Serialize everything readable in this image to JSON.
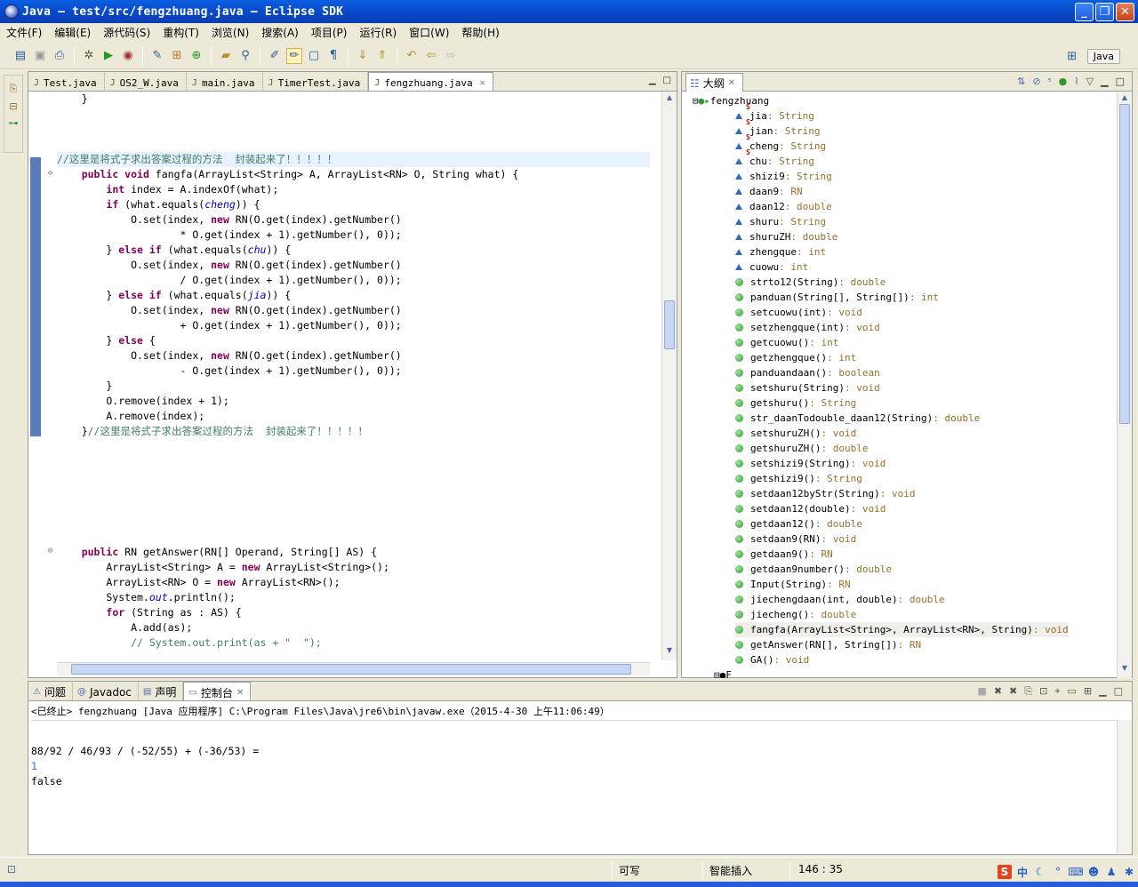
{
  "window": {
    "title": "Java — test/src/fengzhuang.java — Eclipse SDK"
  },
  "menu": [
    "文件(F)",
    "编辑(E)",
    "源代码(S)",
    "重构(T)",
    "浏览(N)",
    "搜索(A)",
    "项目(P)",
    "运行(R)",
    "窗口(W)",
    "帮助(H)"
  ],
  "perspective": {
    "label": "Java"
  },
  "editor": {
    "tabs": [
      {
        "label": "Test.java",
        "active": false
      },
      {
        "label": "OS2_W.java",
        "active": false
      },
      {
        "label": "main.java",
        "active": false
      },
      {
        "label": "TimerTest.java",
        "active": false
      },
      {
        "label": "fengzhuang.java",
        "active": true
      }
    ],
    "lines": [
      {
        "row": 0,
        "html": "    }"
      },
      {
        "row": 4,
        "html": "<span class=\"cm\">//这里是将式子求出答案过程的方法  封装起来了！！！！！</span>",
        "current": true
      },
      {
        "row": 5,
        "html": "    <span class=\"kw\">public void</span> fangfa(ArrayList&lt;String&gt; A, ArrayList&lt;RN&gt; O, String what) {",
        "fold": true
      },
      {
        "row": 6,
        "html": "        <span class=\"kw\">int</span> index = A.indexOf(what);"
      },
      {
        "row": 7,
        "html": "        <span class=\"kw\">if</span> (what.equals(<span class=\"it\">cheng</span>)) {"
      },
      {
        "row": 8,
        "html": "            O.set(index, <span class=\"kw\">new</span> RN(O.get(index).getNumber()"
      },
      {
        "row": 9,
        "html": "                    * O.get(index + 1).getNumber(), 0));"
      },
      {
        "row": 10,
        "html": "        } <span class=\"kw\">else if</span> (what.equals(<span class=\"it\">chu</span>)) {"
      },
      {
        "row": 11,
        "html": "            O.set(index, <span class=\"kw\">new</span> RN(O.get(index).getNumber()"
      },
      {
        "row": 12,
        "html": "                    / O.get(index + 1).getNumber(), 0));"
      },
      {
        "row": 13,
        "html": "        } <span class=\"kw\">else if</span> (what.equals(<span class=\"it\">jia</span>)) {"
      },
      {
        "row": 14,
        "html": "            O.set(index, <span class=\"kw\">new</span> RN(O.get(index).getNumber()"
      },
      {
        "row": 15,
        "html": "                    + O.get(index + 1).getNumber(), 0));"
      },
      {
        "row": 16,
        "html": "        } <span class=\"kw\">else</span> {"
      },
      {
        "row": 17,
        "html": "            O.set(index, <span class=\"kw\">new</span> RN(O.get(index).getNumber()"
      },
      {
        "row": 18,
        "html": "                    - O.get(index + 1).getNumber(), 0));"
      },
      {
        "row": 19,
        "html": "        }"
      },
      {
        "row": 20,
        "html": "        O.remove(index + 1);"
      },
      {
        "row": 21,
        "html": "        A.remove(index);"
      },
      {
        "row": 22,
        "html": "    }<span class=\"cm\">//这里是将式子求出答案过程的方法  封装起来了！！！！！</span>"
      },
      {
        "row": 30,
        "html": "    <span class=\"kw\">public</span> RN getAnswer(RN[] Operand, String[] AS) {",
        "fold": true
      },
      {
        "row": 31,
        "html": "        ArrayList&lt;String&gt; A = <span class=\"kw\">new</span> ArrayList&lt;String&gt;();"
      },
      {
        "row": 32,
        "html": "        ArrayList&lt;RN&gt; O = <span class=\"kw\">new</span> ArrayList&lt;RN&gt;();"
      },
      {
        "row": 33,
        "html": "        System.<span class=\"it\">out</span>.println();"
      },
      {
        "row": 34,
        "html": "        <span class=\"kw\">for</span> (String as : AS) {"
      },
      {
        "row": 35,
        "html": "            A.add(as);"
      },
      {
        "row": 36,
        "html": "            <span class=\"cm\">// System.out.print(as + \"  \");</span>"
      }
    ]
  },
  "outline": {
    "title": "大纲",
    "class_name": "fengzhuang",
    "items": [
      {
        "name": "jia",
        "type": " : String",
        "kind": "field",
        "static": true
      },
      {
        "name": "jian",
        "type": " : String",
        "kind": "field",
        "static": true
      },
      {
        "name": "cheng",
        "type": " : String",
        "kind": "field",
        "static": true
      },
      {
        "name": "chu",
        "type": " : String",
        "kind": "field",
        "static": true
      },
      {
        "name": "shizi9",
        "type": " : String",
        "kind": "field"
      },
      {
        "name": "daan9",
        "type": " : RN",
        "kind": "field"
      },
      {
        "name": "daan12",
        "type": " : double",
        "kind": "field"
      },
      {
        "name": "shuru",
        "type": " : String",
        "kind": "field"
      },
      {
        "name": "shuruZH",
        "type": " : double",
        "kind": "field"
      },
      {
        "name": "zhengque",
        "type": " : int",
        "kind": "field"
      },
      {
        "name": "cuowu",
        "type": " : int",
        "kind": "field"
      },
      {
        "name": "strto12(String)",
        "type": " : double",
        "kind": "method"
      },
      {
        "name": "panduan(String[], String[])",
        "type": " : int",
        "kind": "method"
      },
      {
        "name": "setcuowu(int)",
        "type": " : void",
        "kind": "method"
      },
      {
        "name": "setzhengque(int)",
        "type": " : void",
        "kind": "method"
      },
      {
        "name": "getcuowu()",
        "type": " : int",
        "kind": "method"
      },
      {
        "name": "getzhengque()",
        "type": " : int",
        "kind": "method"
      },
      {
        "name": "panduandaan()",
        "type": " : boolean",
        "kind": "method"
      },
      {
        "name": "setshuru(String)",
        "type": " : void",
        "kind": "method"
      },
      {
        "name": "getshuru()",
        "type": " : String",
        "kind": "method"
      },
      {
        "name": "str_daanTodouble_daan12(String)",
        "type": " : double",
        "kind": "method"
      },
      {
        "name": "setshuruZH()",
        "type": " : void",
        "kind": "method"
      },
      {
        "name": "getshuruZH()",
        "type": " : double",
        "kind": "method"
      },
      {
        "name": "setshizi9(String)",
        "type": " : void",
        "kind": "method"
      },
      {
        "name": "getshizi9()",
        "type": " : String",
        "kind": "method"
      },
      {
        "name": "setdaan12byStr(String)",
        "type": " : void",
        "kind": "method"
      },
      {
        "name": "setdaan12(double)",
        "type": " : void",
        "kind": "method"
      },
      {
        "name": "getdaan12()",
        "type": " : double",
        "kind": "method"
      },
      {
        "name": "setdaan9(RN)",
        "type": " : void",
        "kind": "method"
      },
      {
        "name": "getdaan9()",
        "type": " : RN",
        "kind": "method"
      },
      {
        "name": "getdaan9number()",
        "type": " : double",
        "kind": "method"
      },
      {
        "name": "Input(String)",
        "type": " : RN",
        "kind": "method"
      },
      {
        "name": "jiechengdaan(int, double)",
        "type": " : double",
        "kind": "method"
      },
      {
        "name": "jiecheng()",
        "type": " : double",
        "kind": "method"
      },
      {
        "name": "fangfa(ArrayList<String>, ArrayList<RN>, String)",
        "type": " : void",
        "kind": "method",
        "selected": true
      },
      {
        "name": "getAnswer(RN[], String[])",
        "type": " : RN",
        "kind": "method"
      },
      {
        "name": "GA()",
        "type": " : void",
        "kind": "method"
      }
    ],
    "next_class": "F"
  },
  "console": {
    "tabs": [
      "问题",
      "Javadoc",
      "声明",
      "控制台"
    ],
    "active_tab": "控制台",
    "description": "<已终止> fengzhuang [Java 应用程序] C:\\Program Files\\Java\\jre6\\bin\\javaw.exe（2015-4-30 上午11:06:49）",
    "output": [
      {
        "row": 3,
        "text": "88/92 / 46/93 / (-52/55) + (-36/53) =",
        "color": "#000000"
      },
      {
        "row": 4,
        "text": "1",
        "color": "#2a7fd4"
      },
      {
        "row": 5,
        "text": "false",
        "color": "#000000"
      }
    ]
  },
  "status": {
    "writable": "可写",
    "insert_mode": "智能插入",
    "position": "146 : 35"
  },
  "ime": {
    "label": "中"
  }
}
